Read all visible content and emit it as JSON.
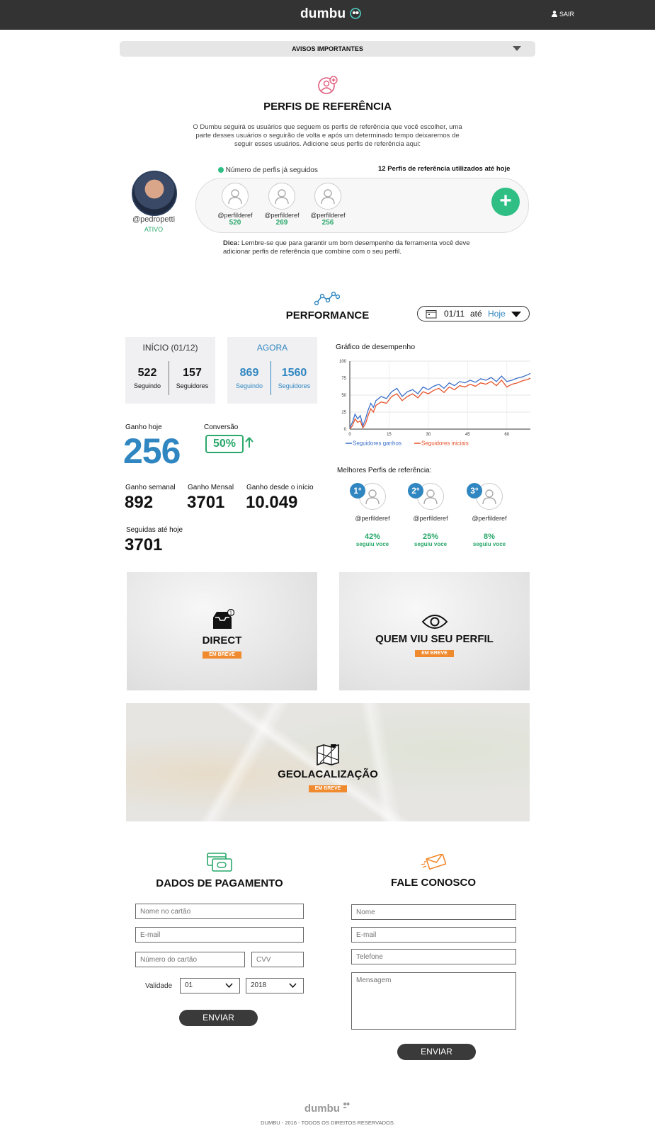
{
  "header": {
    "logo": "dumbu",
    "logout_label": "SAIR"
  },
  "notices": {
    "label": "AVISOS IMPORTANTES"
  },
  "references": {
    "title": "PERFIS DE REFERÊNCIA",
    "intro_1": "O Dumbu seguirá os usuários que seguem os perfis de referência que você escolher, uma",
    "intro_2": "parte desses usuários o seguirão de volta e após um determinado tempo deixaremos de",
    "intro_3": "seguir esses usuários.  Adicione seus perfis de referência aqui:",
    "legend": "Número de perfis já seguidos",
    "total_used": "12 Perfis de referência utilizados até hoje",
    "user": {
      "handle": "@pedropetti",
      "status": "ATIVO"
    },
    "items": [
      {
        "name": "@perfilderef",
        "count": "520"
      },
      {
        "name": "@perfilderef",
        "count": "269"
      },
      {
        "name": "@perfilderef",
        "count": "256"
      }
    ],
    "tip_label": "Dica:",
    "tip_1": " Lembre-se que para garantir um bom desempenho da ferramenta você deve",
    "tip_2": "adicionar perfis de referência que combine com o seu perfil."
  },
  "performance": {
    "title": "PERFORMANCE",
    "date_from": "01/11",
    "date_sep": "até",
    "date_to": "Hoje",
    "start": {
      "title": "INÍCIO (01/12)",
      "following": "522",
      "following_label": "Seguindo",
      "followers": "157",
      "followers_label": "Seguidores"
    },
    "now": {
      "title": "AGORA",
      "following": "869",
      "following_label": "Seguindo",
      "followers": "1560",
      "followers_label": "Seguidores"
    },
    "gain_today_label": "Ganho hoje",
    "gain_today": "256",
    "conversion_label": "Conversão",
    "conversion": "50%",
    "weekly_label": "Ganho semanal",
    "weekly": "892",
    "monthly_label": "Ganho Mensal",
    "monthly": "3701",
    "since_label": "Ganho desde o início",
    "since": "10.049",
    "followed_label": "Seguidas até hoje",
    "followed": "3701",
    "best_title": "Melhores Perfis de referência:",
    "best": [
      {
        "rank": "1°",
        "name": "@perfilderef",
        "pct": "42%",
        "sub": "seguiu voce"
      },
      {
        "rank": "2°",
        "name": "@perfilderef",
        "pct": "25%",
        "sub": "seguiu voce"
      },
      {
        "rank": "3°",
        "name": "@perfilderef",
        "pct": "8%",
        "sub": "seguiu voce"
      }
    ]
  },
  "chart_data": {
    "type": "line",
    "title": "Gráfico de desempenho",
    "xlabel": "",
    "ylabel": "",
    "xlim": [
      0,
      69
    ],
    "ylim": [
      0,
      100
    ],
    "x_ticks": [
      "0",
      "15",
      "30",
      "45",
      "60"
    ],
    "y_ticks": [
      "0",
      "25",
      "50",
      "75",
      "100"
    ],
    "legend_position": "bottom-left",
    "series": [
      {
        "name": "Seguidores ganhos",
        "color": "#3b6fc9",
        "x": [
          0,
          1,
          2,
          3,
          4,
          5,
          6,
          7,
          8,
          9,
          10,
          12,
          14,
          16,
          18,
          20,
          22,
          24,
          26,
          28,
          30,
          32,
          34,
          36,
          38,
          40,
          42,
          44,
          46,
          48,
          50,
          52,
          54,
          56,
          58,
          60,
          62,
          64,
          66,
          68,
          69
        ],
        "y": [
          2,
          10,
          22,
          15,
          20,
          5,
          15,
          28,
          38,
          32,
          42,
          48,
          45,
          55,
          60,
          48,
          55,
          58,
          52,
          62,
          58,
          63,
          66,
          60,
          68,
          64,
          70,
          68,
          72,
          69,
          74,
          72,
          76,
          70,
          78,
          70,
          72,
          75,
          77,
          80,
          82
        ]
      },
      {
        "name": "Seguidores iniciais",
        "color": "#e5532d",
        "x": [
          0,
          1,
          2,
          3,
          4,
          5,
          6,
          7,
          8,
          9,
          10,
          12,
          14,
          16,
          18,
          20,
          22,
          24,
          26,
          28,
          30,
          32,
          34,
          36,
          38,
          40,
          42,
          44,
          46,
          48,
          50,
          52,
          54,
          56,
          58,
          60,
          62,
          64,
          66,
          68,
          69
        ],
        "y": [
          0,
          5,
          15,
          10,
          12,
          2,
          8,
          20,
          30,
          25,
          35,
          40,
          38,
          48,
          52,
          42,
          48,
          52,
          46,
          55,
          52,
          57,
          60,
          54,
          62,
          58,
          64,
          62,
          66,
          63,
          68,
          66,
          70,
          64,
          72,
          62,
          66,
          68,
          71,
          73,
          75
        ]
      }
    ]
  },
  "tiles": {
    "direct": {
      "title": "DIRECT",
      "badge": "EM BREVE"
    },
    "viewers": {
      "title": "QUEM VIU SEU PERFIL",
      "badge": "EM BREVE"
    },
    "geo": {
      "title": "GEOLACALIZAÇÃO",
      "badge": "EM BREVE"
    }
  },
  "payment": {
    "title": "DADOS DE PAGAMENTO",
    "name_ph": "Nome no cartão",
    "email_ph": "E-mail",
    "card_ph": "Número do cartão",
    "cvv_ph": "CVV",
    "validity_label": "Validade",
    "month": "01",
    "year": "2018",
    "submit": "ENVIAR"
  },
  "contact": {
    "title": "FALE CONOSCO",
    "name_ph": "Nome",
    "email_ph": "E-mail",
    "phone_ph": "Telefone",
    "message_ph": "Mensagem",
    "submit": "ENVIAR"
  },
  "footer": {
    "logo": "dumbu",
    "copyright": "DUMBU - 2016 - TODOS OS DIREITOS RESERVADOS"
  }
}
